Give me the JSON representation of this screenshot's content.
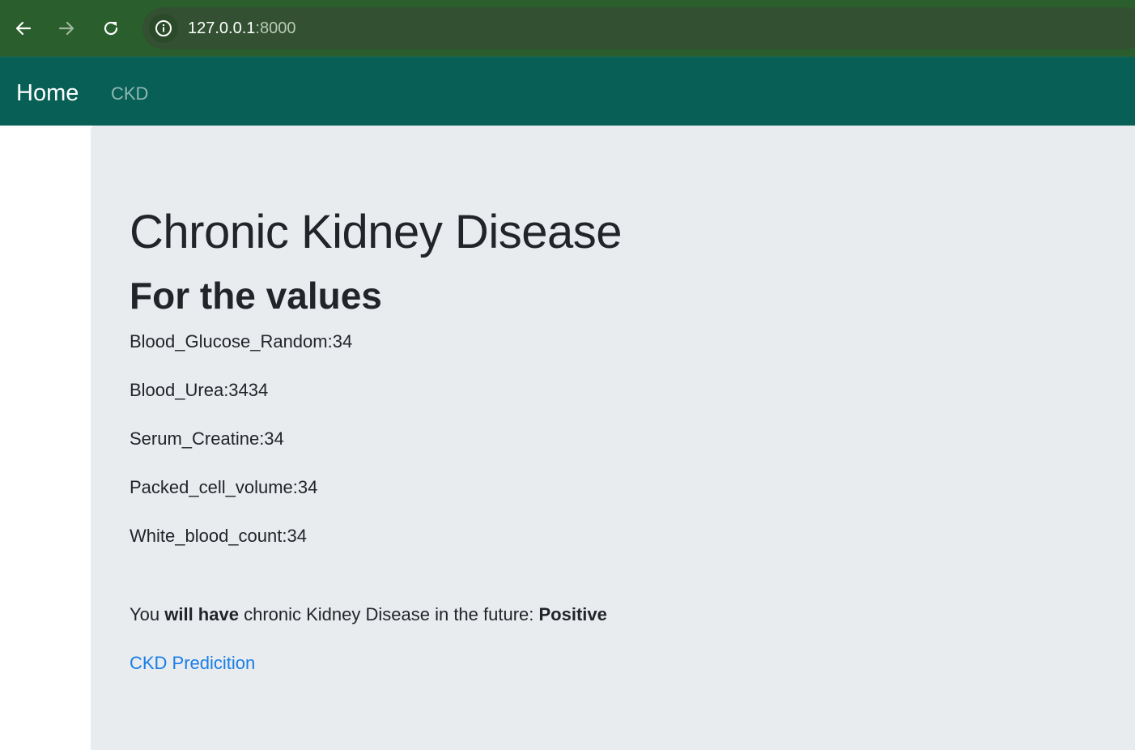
{
  "browser": {
    "url_host": "127.0.0.1",
    "url_port": ":8000",
    "icons": {
      "back": "back-arrow-icon",
      "forward": "forward-arrow-icon",
      "reload": "reload-icon",
      "site_info": "info-icon"
    },
    "colors": {
      "chrome_bg": "#2a5e2c",
      "omnibox_bg": "#335132"
    }
  },
  "navbar": {
    "brand": "Home",
    "links": [
      "CKD"
    ],
    "color": "#075f55"
  },
  "main": {
    "title": "Chronic Kidney Disease",
    "subtitle": "For the values",
    "values": [
      "Blood_Glucose_Random:34",
      "Blood_Urea:3434",
      "Serum_Creatine:34",
      "Packed_cell_volume:34",
      "White_blood_count:34"
    ],
    "result": {
      "prefix": "You ",
      "emphasis": "will have",
      "middle": " chronic Kidney Disease in the future: ",
      "outcome": "Positive"
    },
    "link": "CKD Predicition",
    "colors": {
      "background": "#e9ecef",
      "link": "#1a7ee6"
    }
  }
}
